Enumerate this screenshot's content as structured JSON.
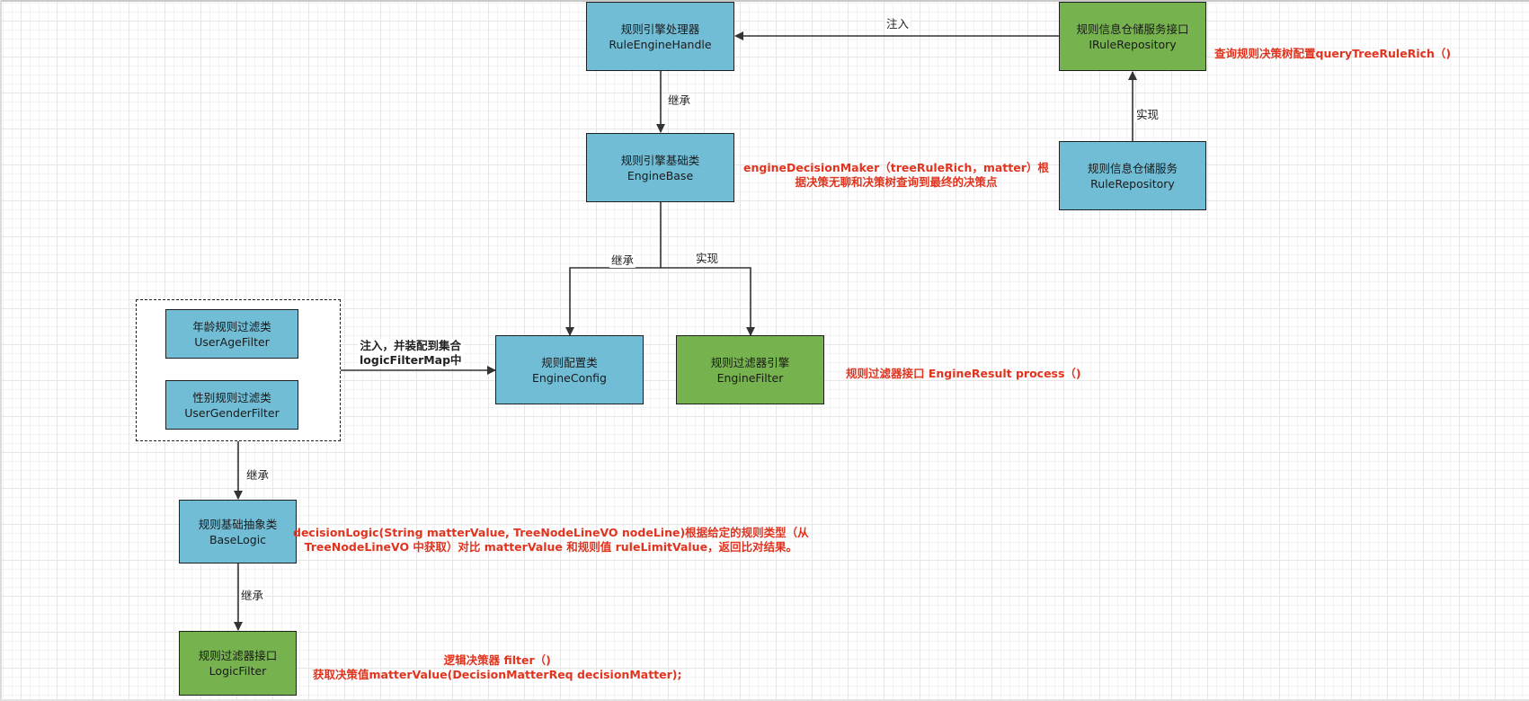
{
  "nodes": {
    "rule_engine_handle": {
      "cn": "规则引擎处理器",
      "en": "RuleEngineHandle"
    },
    "irule_repository": {
      "cn": "规则信息仓储服务接口",
      "en": "IRuleRepository"
    },
    "rule_repository": {
      "cn": "规则信息仓储服务",
      "en": "RuleRepository"
    },
    "engine_base": {
      "cn": "规则引擎基础类",
      "en": "EngineBase"
    },
    "engine_config": {
      "cn": "规则配置类",
      "en": "EngineConfig"
    },
    "engine_filter": {
      "cn": "规则过滤器引擎",
      "en": "EngineFilter"
    },
    "user_age_filter": {
      "cn": "年龄规则过滤类",
      "en": "UserAgeFilter"
    },
    "user_gender_filter": {
      "cn": "性别规则过滤类",
      "en": "UserGenderFilter"
    },
    "base_logic": {
      "cn": "规则基础抽象类",
      "en": "BaseLogic"
    },
    "logic_filter": {
      "cn": "规则过滤器接口",
      "en": "LogicFilter"
    }
  },
  "edges": {
    "inject_repo": "注入",
    "extend_base": "继承",
    "implement_repo": "实现",
    "extend_config": "继承",
    "implement_filter": "实现",
    "inject_map_line1": "注入，并装配到集合",
    "inject_map_line2": "logicFilterMap中",
    "extend_baselogic": "继承",
    "extend_logicfilter": "继承"
  },
  "notes": {
    "query_tree": "查询规则决策树配置queryTreeRuleRich（)",
    "decision_maker_line1": "engineDecisionMaker（treeRuleRich，matter）根",
    "decision_maker_line2": "据决策无聊和决策树查询到最终的决策点",
    "engine_filter_process": "规则过滤器接口 EngineResult process（)",
    "decision_logic_line1": "decisionLogic(String matterValue, TreeNodeLineVO nodeLine)根据给定的规则类型（从",
    "decision_logic_line2": "TreeNodeLineVO 中获取）对比 matterValue 和规则值 ruleLimitValue，返回比对结果。",
    "logic_filter_line1": "逻辑决策器 filter（)",
    "logic_filter_line2": "获取决策值matterValue(DecisionMatterReq decisionMatter);"
  },
  "colors": {
    "blue_box": "#71bdd6",
    "green_box": "#76b34e",
    "note_text": "#e0341f",
    "line": "#333333"
  }
}
